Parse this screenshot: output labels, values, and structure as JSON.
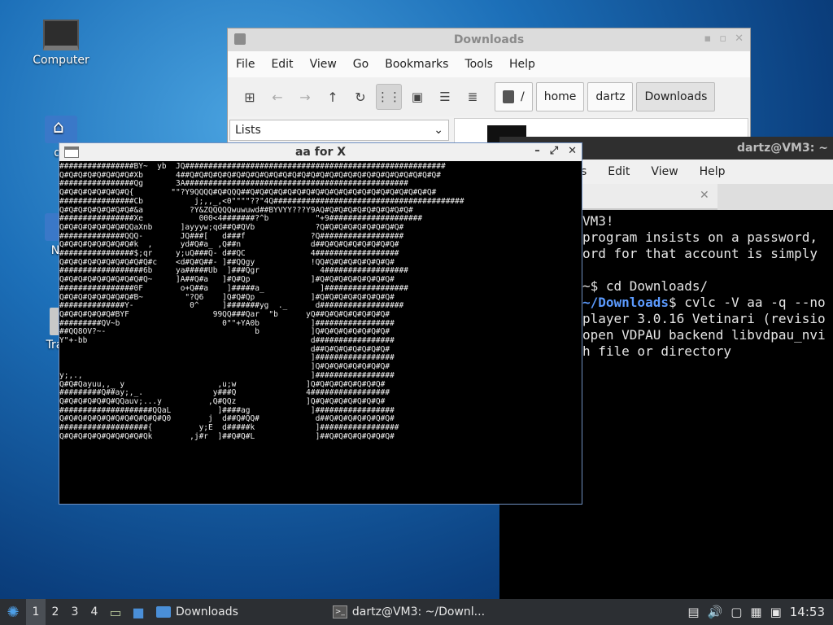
{
  "desktop": {
    "icons": [
      {
        "label": "Computer"
      },
      {
        "label": "da"
      },
      {
        "label": "Net"
      },
      {
        "label": "Trash"
      }
    ]
  },
  "file_manager": {
    "title": "Downloads",
    "menu": [
      "File",
      "Edit",
      "View",
      "Go",
      "Bookmarks",
      "Tools",
      "Help"
    ],
    "breadcrumbs": [
      "/",
      "home",
      "dartz",
      "Downloads"
    ],
    "side_pane_mode": "Lists"
  },
  "terminal": {
    "title": "dartz@VM3: ~",
    "menu": [
      "s",
      "Edit",
      "View",
      "Help"
    ],
    "tab_close": "✕",
    "lines": [
      {
        "text": "VM3!"
      },
      {
        "text": "program insists on a password,"
      },
      {
        "text": "ord for that account is simply"
      },
      {
        "text": ""
      },
      {
        "text": "~$ cd Downloads/"
      },
      {
        "path": "~/Downloads",
        "text": "$ cvlc -V aa -q --no"
      },
      {
        "text": "player 3.0.16 Vetinari (revisio"
      },
      {
        "text": "open VDPAU backend libvdpau_nvi"
      },
      {
        "text": "h file or directory"
      }
    ]
  },
  "aa_window": {
    "title": "aa for X",
    "controls": [
      "–",
      "⤢",
      "✕"
    ],
    "ascii_lines": [
      "################BY~  yb  JQ########################################################",
      "Q#Q#Q#Q#Q#Q#Q#Q#Xb       4##Q#Q#Q#Q#Q#Q#Q#Q#Q#Q#Q#Q#Q#Q#Q#Q#Q#Q#Q#Q#Q#Q#Q#Q#Q#Q#Q#",
      "################Qg       3A################################################",
      "Q#Q#Q#Q#Q#Q#Q#Q{        \"\"?Y9QQQQ#Q#QQQ##Q#Q#Q#Q#Q#Q#Q#Q#Q#Q#Q#Q#Q#Q#Q#Q#Q#Q#Q#Q#",
      "################Cb           j;,,_,<0\"\"\"\"??\"4Q#########################################",
      "Q#Q#Q#Q#Q#Q#Q#Q#&a          ?Y&ZQQQQQwuwuwd##BYVYY???Y9AQ#Q#Q#Q#Q#Q#Q#Q#Q#Q#",
      "################Xe            000<4#######?^b          \"+9####################",
      "Q#Q#Q#Q#Q#Q#Q#QQaXnb      ]ayyyw;qd##Q#QVb             ?Q#Q#Q#Q#Q#Q#Q#Q#Q#",
      "##############QQQ-        JQ###[   d###f              ?Q##################",
      "Q#Q#Q#Q#Q#Q#Q#Q#k  ,      yd#Q#a_ ,Q##n               d##Q#Q#Q#Q#Q#Q#Q#Q#",
      "################$;qr     y;uQ###Q- d##QC              4##################",
      "Q#Q#Q#Q#Q#Q#Q#Q#Q#Q#c    <d#Q#Q##- ]##QQgy            !QQ#Q#Q#Q#Q#Q#Q#Q#",
      "##################6b     ya#####Ub  ]###Qgr             4##################",
      "Q#Q#Q#Q#Q#Q#Q#Q#Q#Q~     ]A##Q#a   ]#Q#Qp             ]#Q#Q#Q#Q#Q#Q#Q#Q#",
      "################0F        o+Q##a    ]#####a_            ]##################",
      "Q#Q#Q#Q#Q#Q#Q#Q#B~         \"?Q6    ]Q#Q#Qp            ]#Q#Q#Q#Q#Q#Q#Q#Q#",
      "##############Y-            0^     ]#######yg  ._      d##################",
      "Q#Q#Q#Q#Q#Q#BYF                  99QQ###Qar  \"b      yQ##Q#Q#Q#Q#Q#Q#Q#",
      "#########QV~b                      0\"\"+YA0b           ]#################",
      "##QQ8OV?~-                                b           ]Q#Q#Q#Q#Q#Q#Q#Q#",
      "Y\"+-bb                                                d#################",
      "                                                      d##Q#Q#Q#Q#Q#Q#Q#",
      "                                                      ]#################",
      "                                                      ]Q#Q#Q#Q#Q#Q#Q#Q#",
      "y;,.,                                                 ]#################",
      "Q#Q#Qayuu,,_ y                    ,u;w               ]Q#Q#Q#Q#Q#Q#Q#Q#",
      "#########Q##ay;,_.               y###Q               4#################",
      "Q#Q#Q#Q#Q#Q#QQauv;...y          ,Q#QQz               ]Q#Q#Q#Q#Q#Q#Q#Q#",
      "####################QQaL          ]####ag             ]#################",
      "Q#Q#Q#Q#Q#Q#Q#Q#Q#Q#Q#Q0        j  d##Q#QQ#            d##Q#Q#Q#Q#Q#Q#Q#",
      "###################{          y;E  d#####k             ]#################",
      "Q#Q#Q#Q#Q#Q#Q#Q#Q#Qk        ,j#r  ]##Q#Q#L             ]##Q#Q#Q#Q#Q#Q#Q#"
    ]
  },
  "taskbar": {
    "workspaces": [
      "1",
      "2",
      "3",
      "4"
    ],
    "tasks": [
      {
        "label": "Downloads"
      },
      {
        "label": "dartz@VM3: ~/Downl..."
      }
    ],
    "clock": "14:53"
  }
}
